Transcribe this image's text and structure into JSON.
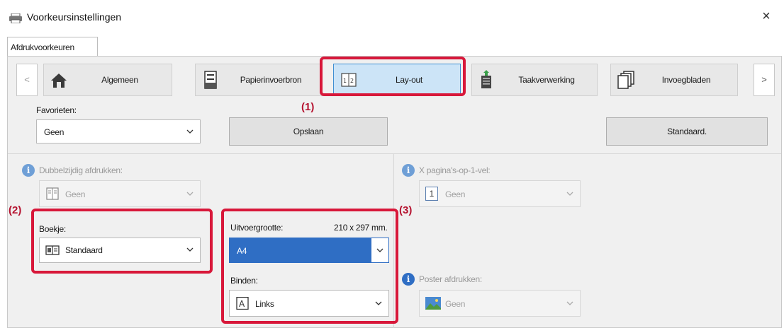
{
  "window": {
    "title": "Voorkeursinstellingen",
    "close_glyph": "×"
  },
  "tabs": [
    {
      "label": "Afdrukvoorkeuren"
    }
  ],
  "nav": {
    "prev_glyph": "<",
    "next_glyph": ">",
    "buttons": [
      {
        "label": "Algemeen",
        "icon": "home-icon"
      },
      {
        "label": "Papierinvoerbron",
        "icon": "paper-tray-icon"
      },
      {
        "label": "Lay-out",
        "icon": "layout-icon",
        "active": true
      },
      {
        "label": "Taakverwerking",
        "icon": "job-handling-icon"
      },
      {
        "label": "Invoegbladen",
        "icon": "insert-sheets-icon"
      }
    ]
  },
  "favorites": {
    "label": "Favorieten:",
    "value": "Geen",
    "save_label": "Opslaan",
    "default_label": "Standaard."
  },
  "duplex": {
    "label": "Dubbelzijdig afdrukken:",
    "value": "Geen"
  },
  "booklet": {
    "label": "Boekje:",
    "value": "Standaard"
  },
  "output_size": {
    "label": "Uitvoergrootte:",
    "dimensions": "210 x 297 mm.",
    "value": "A4"
  },
  "binding": {
    "label": "Binden:",
    "value": "Links"
  },
  "n_up": {
    "label": "X pagina's-op-1-vel:",
    "value": "Geen",
    "icon_text": "1"
  },
  "poster": {
    "label": "Poster afdrukken:",
    "value": "Geen"
  },
  "callouts": {
    "one": "(1)",
    "two": "(2)",
    "three": "(3)"
  },
  "colors": {
    "highlight": "#d8183a",
    "active_tab": "#cce4f7",
    "selection": "#2f6ec4"
  }
}
